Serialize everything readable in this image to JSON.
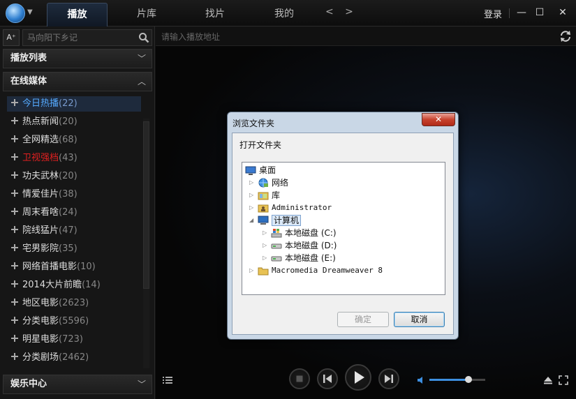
{
  "topbar": {
    "tabs": [
      {
        "label": "播放",
        "active": true
      },
      {
        "label": "片库",
        "active": false
      },
      {
        "label": "找片",
        "active": false
      },
      {
        "label": "我的",
        "active": false
      }
    ],
    "nav_arrows": "< >",
    "login_label": "登录",
    "min_label": "—",
    "max_label": "☐",
    "close_label": "✕"
  },
  "sidebar": {
    "font_btn": "A⁺",
    "search_placeholder": "马向阳下乡记",
    "playlist_label": "播放列表",
    "online_label": "在线媒体",
    "ent_label": "娱乐中心",
    "items": [
      {
        "name": "今日热播",
        "count": "(22)",
        "selected": true,
        "red": false
      },
      {
        "name": "热点新闻",
        "count": "(20)",
        "selected": false,
        "red": false
      },
      {
        "name": "全网精选",
        "count": "(68)",
        "selected": false,
        "red": false
      },
      {
        "name": "卫视强档",
        "count": "(43)",
        "selected": false,
        "red": true
      },
      {
        "name": "功夫武林",
        "count": "(20)",
        "selected": false,
        "red": false
      },
      {
        "name": "情爱佳片",
        "count": "(38)",
        "selected": false,
        "red": false
      },
      {
        "name": "周末看啥",
        "count": "(24)",
        "selected": false,
        "red": false
      },
      {
        "name": "院线猛片",
        "count": "(47)",
        "selected": false,
        "red": false
      },
      {
        "name": "宅男影院",
        "count": "(35)",
        "selected": false,
        "red": false
      },
      {
        "name": "网络首播电影",
        "count": "(10)",
        "selected": false,
        "red": false
      },
      {
        "name": "2014大片前瞻",
        "count": "(14)",
        "selected": false,
        "red": false
      },
      {
        "name": "地区电影",
        "count": "(2623)",
        "selected": false,
        "red": false
      },
      {
        "name": "分类电影",
        "count": "(5596)",
        "selected": false,
        "red": false
      },
      {
        "name": "明星电影",
        "count": "(723)",
        "selected": false,
        "red": false
      },
      {
        "name": "分类剧场",
        "count": "(2462)",
        "selected": false,
        "red": false
      }
    ]
  },
  "main": {
    "url_placeholder": "请输入播放地址",
    "volume_level": 0.7
  },
  "dialog": {
    "title": "浏览文件夹",
    "close_label": "✕",
    "label": "打开文件夹",
    "tree": [
      {
        "label": "桌面",
        "icon": "desktop-icon",
        "indent": 0,
        "arrow": "",
        "mono": false,
        "selected": false
      },
      {
        "label": "网络",
        "icon": "network-icon",
        "indent": 1,
        "arrow": "▷",
        "mono": false,
        "selected": false
      },
      {
        "label": "库",
        "icon": "library-icon",
        "indent": 1,
        "arrow": "▷",
        "mono": false,
        "selected": false
      },
      {
        "label": "Administrator",
        "icon": "user-folder-icon",
        "indent": 1,
        "arrow": "▷",
        "mono": true,
        "selected": false
      },
      {
        "label": "计算机",
        "icon": "computer-icon",
        "indent": 1,
        "arrow": "◢",
        "mono": false,
        "selected": true
      },
      {
        "label": "本地磁盘 (C:)",
        "icon": "system-drive-icon",
        "indent": 2,
        "arrow": "▷",
        "mono": false,
        "selected": false
      },
      {
        "label": "本地磁盘 (D:)",
        "icon": "drive-icon",
        "indent": 2,
        "arrow": "▷",
        "mono": false,
        "selected": false
      },
      {
        "label": "本地磁盘 (E:)",
        "icon": "drive-icon",
        "indent": 2,
        "arrow": "▷",
        "mono": false,
        "selected": false
      },
      {
        "label": "Macromedia Dreamweaver 8",
        "icon": "folder-icon",
        "indent": 1,
        "arrow": "▷",
        "mono": true,
        "selected": false
      }
    ],
    "ok_label": "确定",
    "cancel_label": "取消"
  }
}
